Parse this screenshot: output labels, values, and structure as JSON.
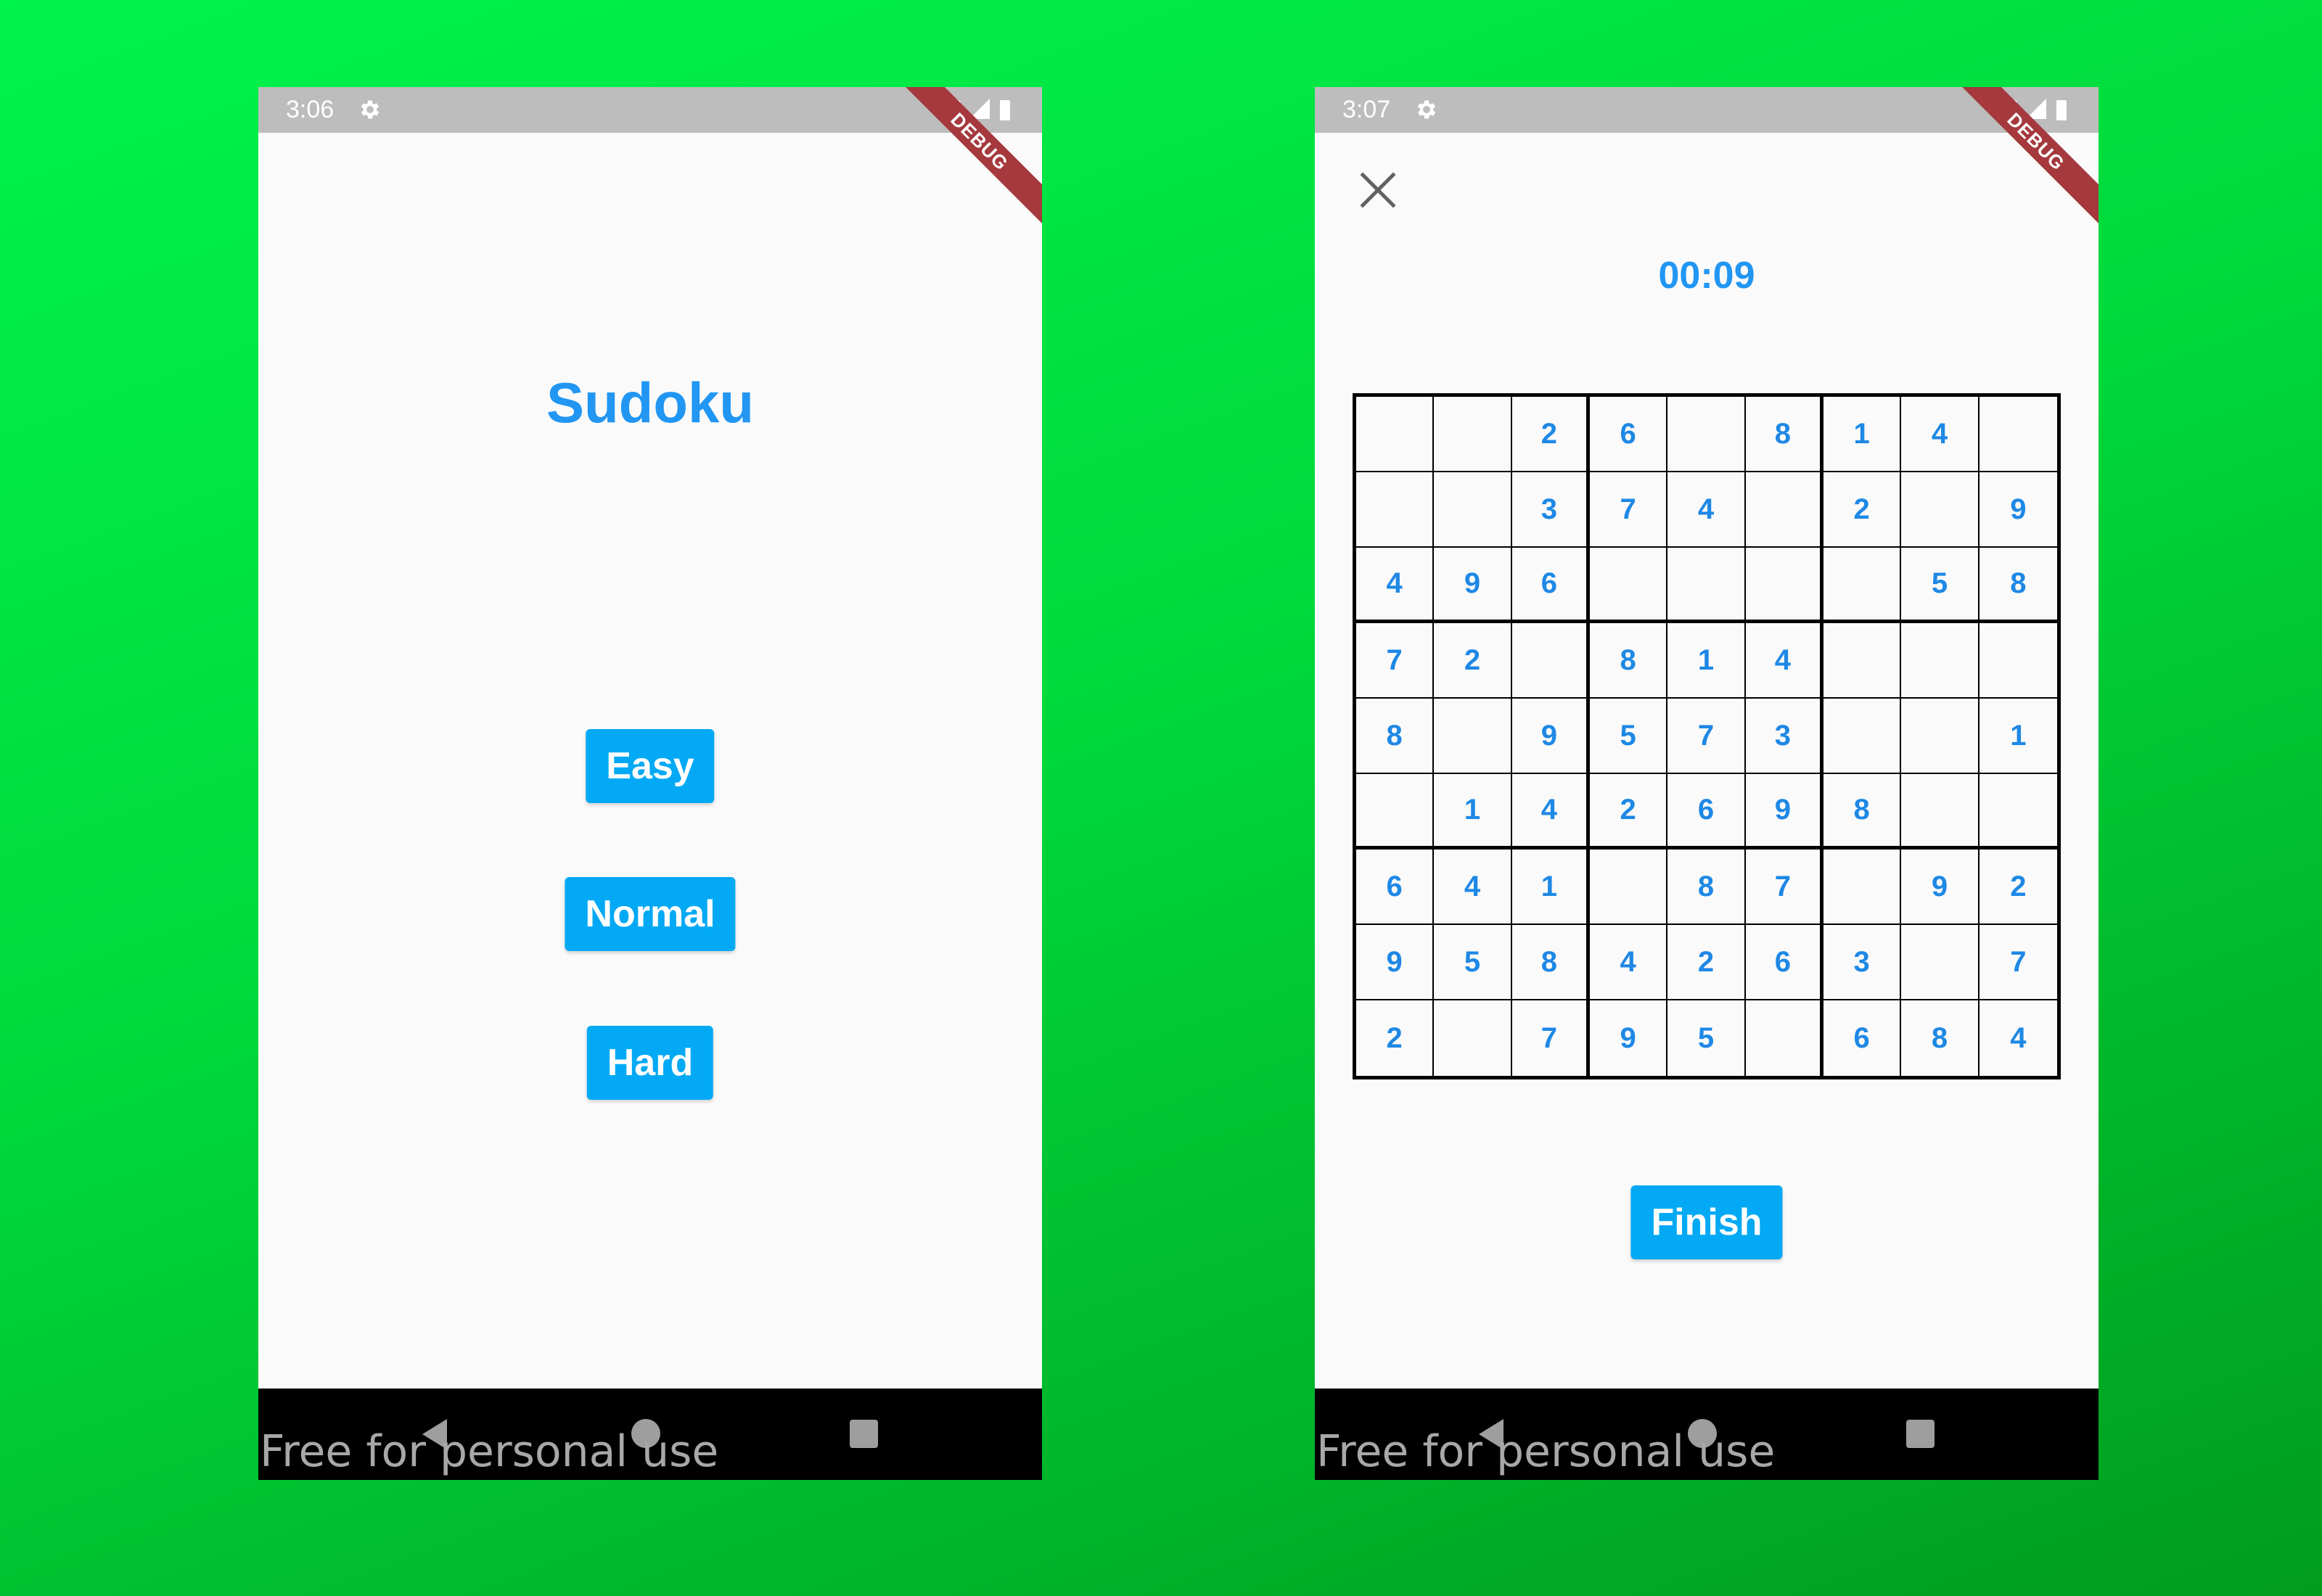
{
  "colors": {
    "accent": "#2196f3",
    "button": "#03a9f4",
    "debug_banner": "#a5393d",
    "background_green": "#00d93b"
  },
  "watermark": "Free for personal use",
  "left_screen": {
    "status": {
      "time": "3:06",
      "debug": "DEBUG"
    },
    "title": "Sudoku",
    "buttons": {
      "easy": "Easy",
      "normal": "Normal",
      "hard": "Hard"
    }
  },
  "right_screen": {
    "status": {
      "time": "3:07",
      "debug": "DEBUG"
    },
    "timer": "00:09",
    "grid": [
      [
        "",
        "",
        "2",
        "6",
        "",
        "8",
        "1",
        "4",
        ""
      ],
      [
        "",
        "",
        "3",
        "7",
        "4",
        "",
        "2",
        "",
        "9"
      ],
      [
        "4",
        "9",
        "6",
        "",
        "",
        "",
        "",
        "5",
        "8"
      ],
      [
        "7",
        "2",
        "",
        "8",
        "1",
        "4",
        "",
        "",
        ""
      ],
      [
        "8",
        "",
        "9",
        "5",
        "7",
        "3",
        "",
        "",
        "1"
      ],
      [
        "",
        "1",
        "4",
        "2",
        "6",
        "9",
        "8",
        "",
        ""
      ],
      [
        "6",
        "4",
        "1",
        "",
        "8",
        "7",
        "",
        "9",
        "2"
      ],
      [
        "9",
        "5",
        "8",
        "4",
        "2",
        "6",
        "3",
        "",
        "7"
      ],
      [
        "2",
        "",
        "7",
        "9",
        "5",
        "",
        "6",
        "8",
        "4"
      ]
    ],
    "finish_label": "Finish"
  }
}
